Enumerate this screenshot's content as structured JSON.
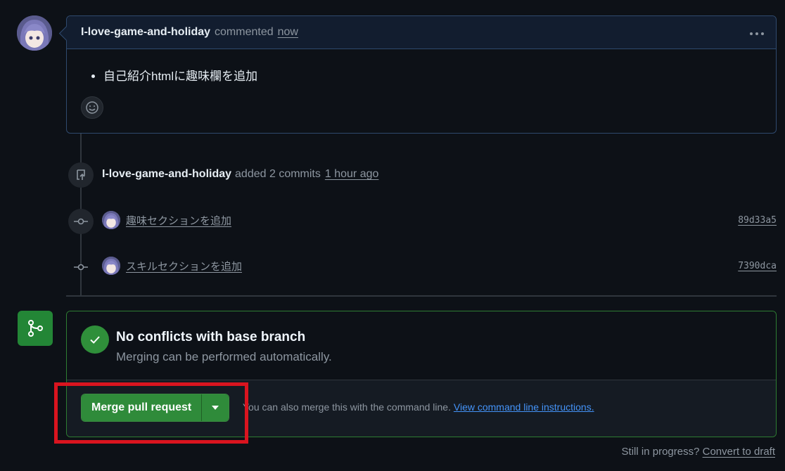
{
  "comment": {
    "author": "I-love-game-and-holiday",
    "action": "commented",
    "time": "now",
    "menu_icon": "kebab-horizontal-icon",
    "items": [
      "自己紹介htmlに趣味欄を追加"
    ],
    "reaction_icon": "smiley-icon"
  },
  "timeline": {
    "push_event": {
      "icon": "repo-push-icon",
      "author": "I-love-game-and-holiday",
      "action": "added 2 commits",
      "time": "1 hour ago"
    },
    "commits": [
      {
        "message": "趣味セクションを追加",
        "sha": "89d33a5"
      },
      {
        "message": "スキルセクションを追加",
        "sha": "7390dca"
      }
    ]
  },
  "merge": {
    "icon": "git-merge-icon",
    "status_icon": "check-icon",
    "title": "No conflicts with base branch",
    "subtitle": "Merging can be performed automatically.",
    "button_label": "Merge pull request",
    "dropdown_icon": "triangle-down-icon",
    "cmd_text": "You can also merge this with the command line.",
    "cmd_link": "View command line instructions.",
    "highlight_color": "#d9141f"
  },
  "footer": {
    "prefix": "Still in progress?",
    "link": "Convert to draft"
  }
}
